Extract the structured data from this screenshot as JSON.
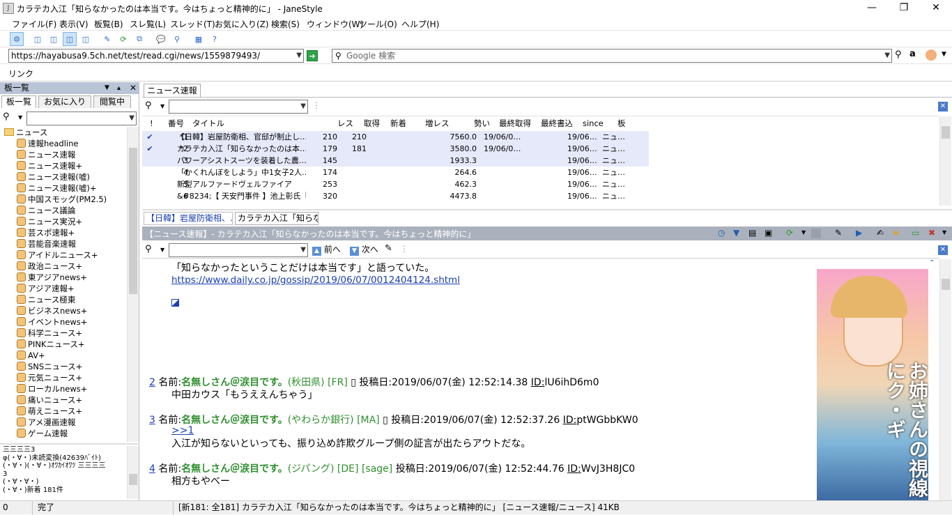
{
  "window": {
    "title": "カラテカ入江「知らなかったのは本当です。今はちょっと精神的に」 - JaneStyle",
    "app_icon_glyph": "J"
  },
  "menu": [
    "ファイル(F)",
    "表示(V)",
    "板覧(B)",
    "スレ覧(L)",
    "スレッド(T)",
    "お気に入り(Z)",
    "検索(S)",
    "ウィンドウ(W)",
    "ツール(O)",
    "ヘルプ(H)"
  ],
  "address": {
    "url": "https://hayabusa9.5ch.net/test/read.cgi/news/1559879493/",
    "search_placeholder": "Google 検索"
  },
  "linkbar": {
    "label": "リンク"
  },
  "board_panel": {
    "title": "板一覧",
    "tabs": [
      "板一覧",
      "お気に入り",
      "閲覧中"
    ],
    "root": "ニュース",
    "items": [
      "速報headline",
      "ニュース速報",
      "ニュース速報+",
      "ニュース速報(嘘)",
      "ニュース速報(嘘)+",
      "中国スモッグ(PM2.5)",
      "ニュース議論",
      "ニュース実況+",
      "芸スポ速報+",
      "芸能音楽速報",
      "アイドルニュース+",
      "政治ニュース+",
      "東アジアnews+",
      "アジア速報+",
      "ニュース極東",
      "ビジネスnews+",
      "イベントnews+",
      "科学ニュース+",
      "PINKニュース+",
      "AV+",
      "SNSニュース+",
      "元気ニュース+",
      "ローカルnews+",
      "痛いニュース+",
      "萌えニュース+",
      "アメ漫画速報",
      "ゲーム速報"
    ],
    "log": [
      "三三三三3",
      "φ(・∀・)未読変換(42639ﾊﾞｲﾄ)",
      "(・∀・)(・∀・)ｵﾜｶｲｵﾜﾂ 三三三三",
      "3",
      "(・∀・∀・)",
      "(・∀・)新着 181件"
    ]
  },
  "thread_list": {
    "tab": "ニュース速報",
    "headers": [
      "!",
      "番号",
      "タイトル",
      "レス",
      "取得",
      "新着",
      "増レス",
      "勢い",
      "最終取得",
      "最終書込",
      "since",
      "板"
    ],
    "rows": [
      {
        "mark": "✔",
        "num": "*1",
        "title": "【日韓】岩屋防衛相、官邸が制止し…",
        "res": "210",
        "got": "210",
        "new": "",
        "inc": "",
        "speed": "7560.0",
        "last_get": "19/06/0…",
        "last_write": "",
        "since": "19/06…",
        "board": "ニュ…"
      },
      {
        "mark": "✔",
        "num": "*2",
        "title": "カラテカ入江「知らなかったのは本…",
        "res": "179",
        "got": "181",
        "new": "",
        "inc": "",
        "speed": "3580.0",
        "last_get": "19/06/0…",
        "last_write": "",
        "since": "19/06…",
        "board": "ニュ…"
      },
      {
        "mark": "",
        "num": "3",
        "title": "パワーアシストスーツを装着した農…",
        "res": "145",
        "got": "",
        "new": "",
        "inc": "",
        "speed": "1933.3",
        "last_get": "",
        "last_write": "",
        "since": "19/06…",
        "board": "ニュ…"
      },
      {
        "mark": "",
        "num": "4",
        "title": "「かくれんぼをしよう」中1女子2人…",
        "res": "174",
        "got": "",
        "new": "",
        "inc": "",
        "speed": "264.6",
        "last_get": "",
        "last_write": "",
        "since": "19/06…",
        "board": "ニュ…"
      },
      {
        "mark": "",
        "num": "5",
        "title": "新型アルファードヴェルファイア",
        "res": "253",
        "got": "",
        "new": "",
        "inc": "",
        "speed": "462.3",
        "last_get": "",
        "last_write": "",
        "since": "19/06…",
        "board": "ニュ…"
      },
      {
        "mark": "",
        "num": "6",
        "title": "&#8234;【 天安門事件 】池上彰氏『…",
        "res": "320",
        "got": "",
        "new": "",
        "inc": "",
        "speed": "4473.8",
        "last_get": "",
        "last_write": "",
        "since": "19/06…",
        "board": "ニュ…"
      }
    ]
  },
  "viewer": {
    "tabs": [
      "【日韓】岩屋防衛相、…",
      "カラテカ入江「知らな…"
    ],
    "header": "【ニュース速報】- カラテカ入江「知らなかったのは本当です。今はちょっと精神的に」",
    "prev_label": "前へ",
    "next_label": "次へ",
    "top_text": "「知らなかったということだけは本当です」と語っていた。",
    "top_link": "https://www.daily.co.jp/gossip/2019/06/07/0012404124.shtml",
    "posts": [
      {
        "num": "2",
        "name_label": "名前:",
        "name": "名無しさん＠涙目です。",
        "meta": "(秋田県) [FR]",
        "date_label": "投稿日:",
        "date": "2019/06/07(金) 12:52:14.38",
        "id_label": "ID:",
        "id": "lU6ihD6m0",
        "body": "中田カウス「もうええんちゃう」",
        "anchor": ""
      },
      {
        "num": "3",
        "name_label": "名前:",
        "name": "名無しさん＠涙目です。",
        "meta": "(やわらか銀行) [MA]",
        "date_label": "投稿日:",
        "date": "2019/06/07(金) 12:52:37.26",
        "id_label": "ID:",
        "id": "ptWGbbKW0",
        "body": "入江が知らないといっても、振り込め詐欺グループ側の証言が出たらアウトだな。",
        "anchor": ">>1"
      },
      {
        "num": "4",
        "name_label": "名前:",
        "name": "名無しさん＠涙目です。",
        "meta": "(ジパング) [DE]",
        "sage": "[sage]",
        "date_label": "投稿日:",
        "date": "2019/06/07(金) 12:52:44.76",
        "id_label": "ID:",
        "id": "WvJ3H8JC0",
        "body": "相方もやべー",
        "anchor": ""
      }
    ],
    "ad_text": "お姉さんの視線にク・ギ"
  },
  "status": {
    "count": "0",
    "state": "完了",
    "info": "[新181: 全181] カラテカ入江「知らなかったのは本当です。今はちょっと精神的に」 [ニュース速報/ニュース] 41KB"
  },
  "colors": {
    "accent": "#1a3fb3",
    "name_green": "#2f8f2f",
    "row_highlight": "#e6e9fa"
  }
}
